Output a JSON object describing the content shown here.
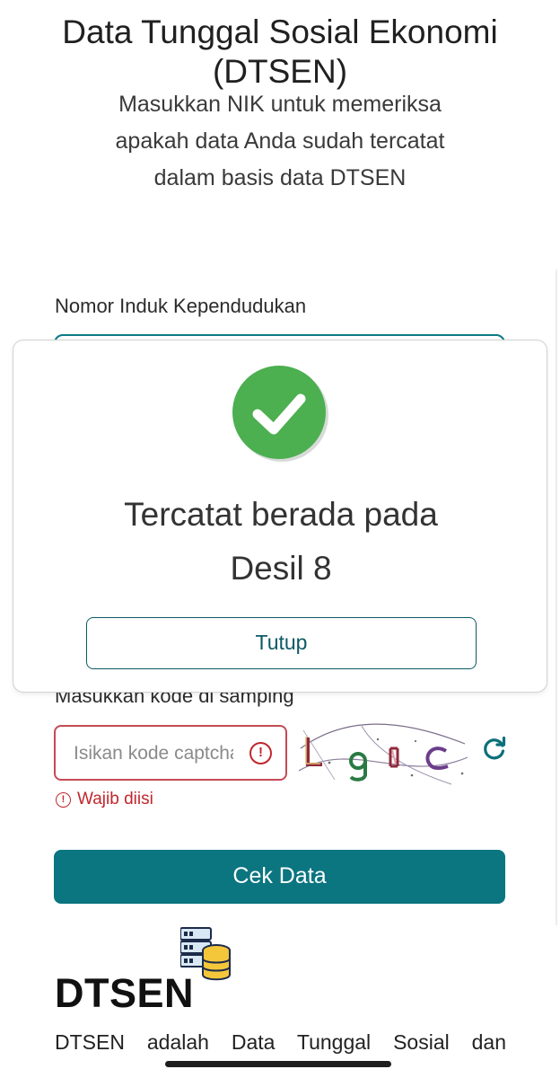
{
  "header": {
    "title": "Data Tunggal Sosial Ekonomi (DTSEN)",
    "subtitle": "Masukkan NIK untuk memeriksa apakah data Anda sudah tercatat dalam basis data DTSEN"
  },
  "form": {
    "nik_label": "Nomor Induk Kependudukan",
    "captcha_label": "Masukkan kode di samping",
    "captcha_placeholder": "Isikan kode captcha",
    "captcha_error": "Wajib diisi",
    "submit_label": "Cek Data"
  },
  "modal": {
    "result_line1": "Tercatat berada pada",
    "result_line2": "Desil 8",
    "close_label": "Tutup"
  },
  "brand": {
    "logo_text": "DTSEN",
    "about_text": "DTSEN adalah Data Tunggal Sosial dan"
  },
  "colors": {
    "accent": "#0b7580",
    "error": "#c0272d",
    "success": "#4caf50"
  },
  "icons": {
    "success": "check-circle-icon",
    "error": "exclamation-circle-icon",
    "refresh": "refresh-icon",
    "logo": "database-server-icon"
  }
}
